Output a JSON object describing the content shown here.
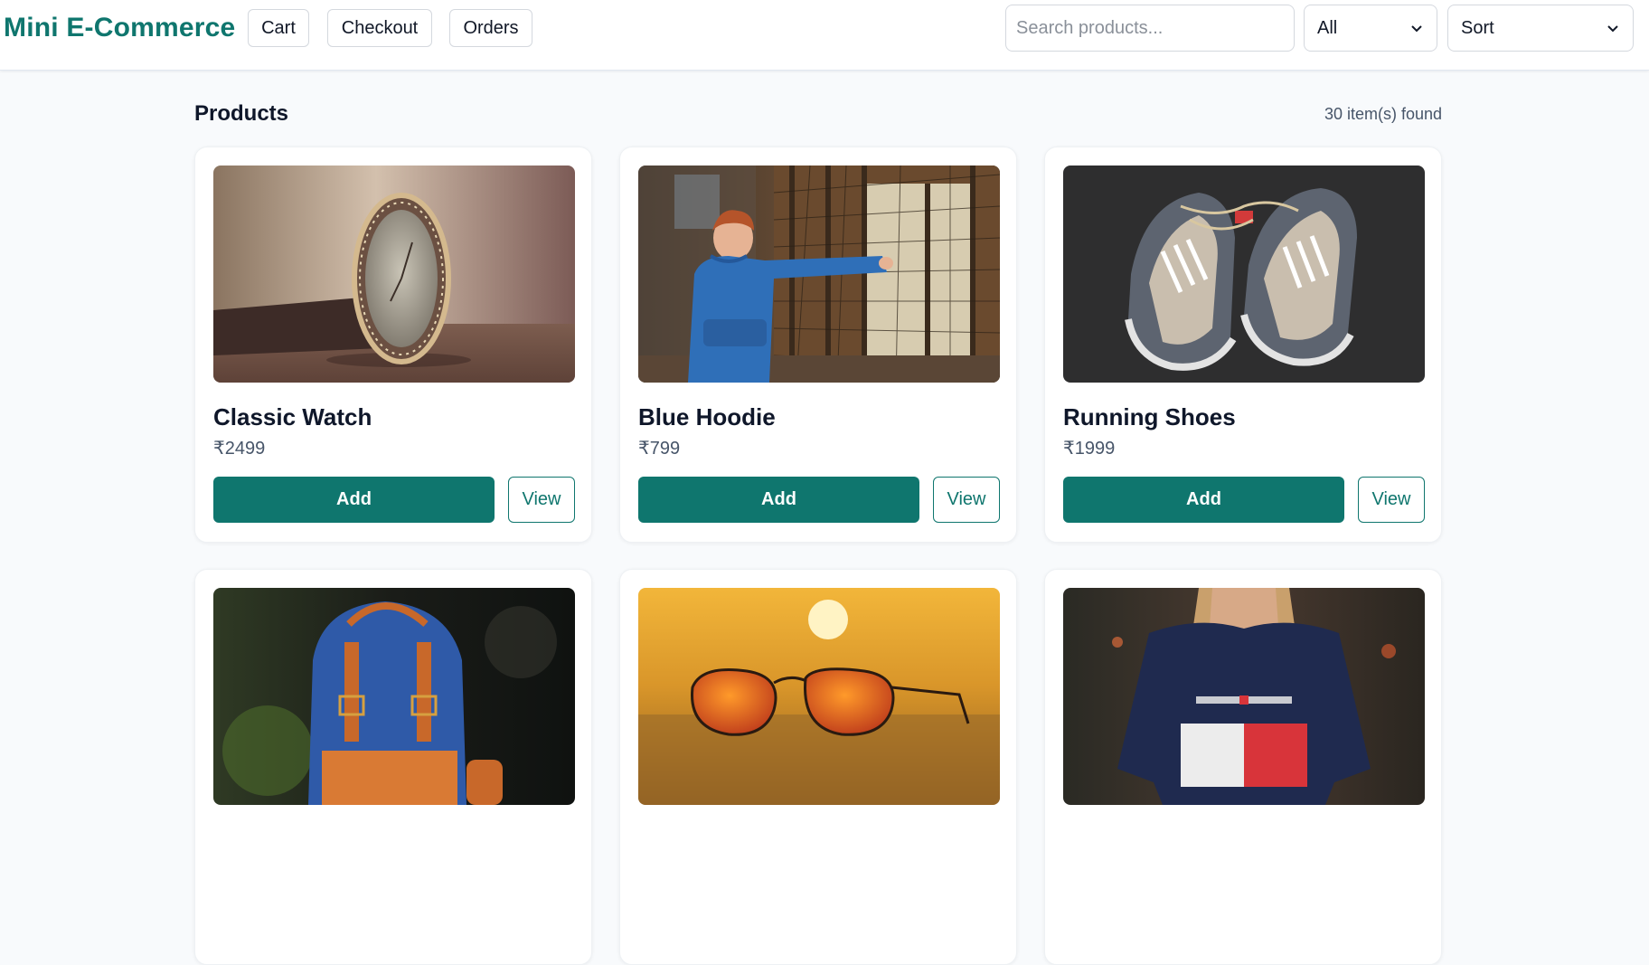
{
  "header": {
    "brand": "Mini E-Commerce",
    "nav": [
      {
        "label": "Cart"
      },
      {
        "label": "Checkout"
      },
      {
        "label": "Orders"
      }
    ],
    "search": {
      "placeholder": "Search products...",
      "value": ""
    },
    "category_filter": {
      "selected": "All"
    },
    "sort": {
      "selected": "Sort"
    }
  },
  "main": {
    "heading": "Products",
    "result_count": "30 item(s) found",
    "products": [
      {
        "name": "Classic Watch",
        "price": "₹2499",
        "add_label": "Add",
        "view_label": "View"
      },
      {
        "name": "Blue Hoodie",
        "price": "₹799",
        "add_label": "Add",
        "view_label": "View"
      },
      {
        "name": "Running Shoes",
        "price": "₹1999",
        "add_label": "Add",
        "view_label": "View"
      },
      {
        "name": "",
        "price": "",
        "add_label": "",
        "view_label": ""
      },
      {
        "name": "",
        "price": "",
        "add_label": "",
        "view_label": ""
      },
      {
        "name": "",
        "price": "",
        "add_label": "",
        "view_label": ""
      }
    ]
  },
  "colors": {
    "accent": "#0f766e",
    "page_background": "#f8fafc",
    "card_background": "#ffffff",
    "muted_text": "#475569"
  }
}
